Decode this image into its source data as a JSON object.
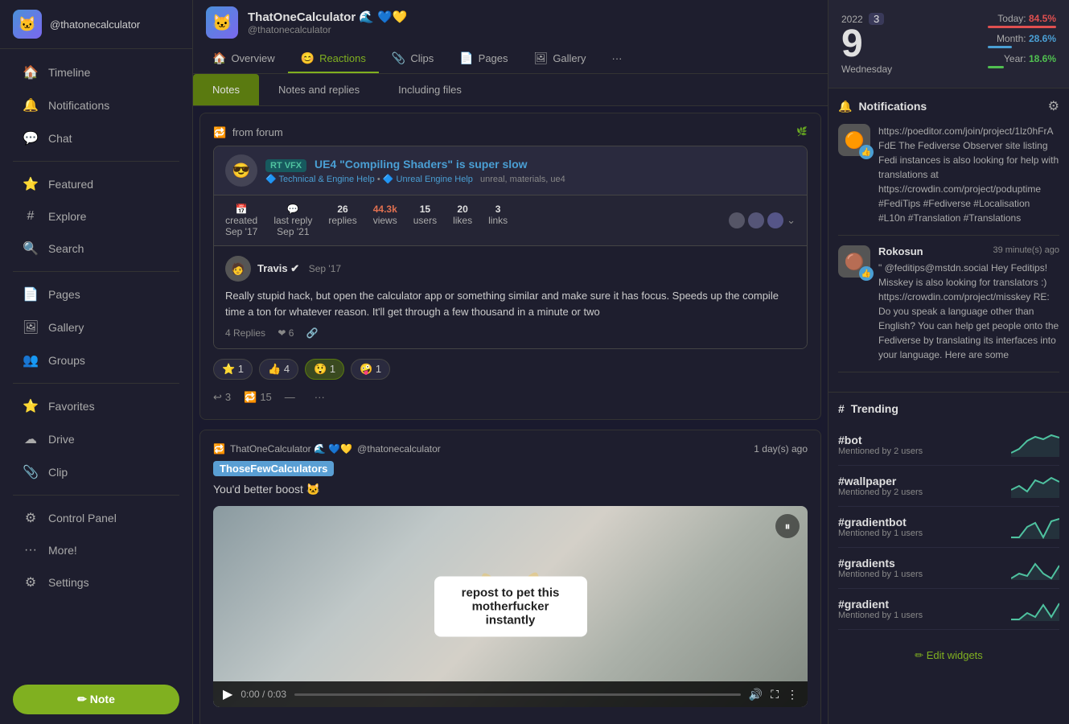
{
  "sidebar": {
    "username": "@thatonecalculator",
    "avatar_emoji": "🐱",
    "nav_items": [
      {
        "id": "timeline",
        "label": "Timeline",
        "icon": "🏠"
      },
      {
        "id": "notifications",
        "label": "Notifications",
        "icon": "🔔"
      },
      {
        "id": "chat",
        "label": "Chat",
        "icon": "💬"
      },
      {
        "id": "featured",
        "label": "Featured",
        "icon": "⭐"
      },
      {
        "id": "explore",
        "label": "Explore",
        "icon": "#"
      },
      {
        "id": "search",
        "label": "Search",
        "icon": "🔍"
      },
      {
        "id": "pages",
        "label": "Pages",
        "icon": "📄"
      },
      {
        "id": "gallery",
        "label": "Gallery",
        "icon": "🖼"
      },
      {
        "id": "groups",
        "label": "Groups",
        "icon": "👥"
      },
      {
        "id": "favorites",
        "label": "Favorites",
        "icon": "⭐"
      },
      {
        "id": "drive",
        "label": "Drive",
        "icon": "☁"
      },
      {
        "id": "clip",
        "label": "Clip",
        "icon": "📎"
      },
      {
        "id": "control_panel",
        "label": "Control Panel",
        "icon": "⚙"
      },
      {
        "id": "more",
        "label": "More!",
        "icon": "..."
      },
      {
        "id": "settings",
        "label": "Settings",
        "icon": "⚙"
      }
    ],
    "note_button": "✏ Note"
  },
  "profile_header": {
    "avatar_emoji": "🐱",
    "name": "ThatOneCalculator 🌊 💙💛",
    "handle": "@thatonecalculator",
    "tabs": [
      {
        "id": "overview",
        "label": "Overview",
        "icon": "🏠",
        "active": false
      },
      {
        "id": "reactions",
        "label": "Reactions",
        "icon": "😊",
        "active": true
      },
      {
        "id": "clips",
        "label": "Clips",
        "icon": "📎"
      },
      {
        "id": "pages",
        "label": "Pages",
        "icon": "📄"
      },
      {
        "id": "gallery",
        "label": "Gallery",
        "icon": "🖼"
      },
      {
        "id": "more",
        "label": "...",
        "icon": ""
      }
    ]
  },
  "content_tabs": [
    {
      "id": "notes",
      "label": "Notes",
      "active": true
    },
    {
      "id": "notes_replies",
      "label": "Notes and replies",
      "active": false
    },
    {
      "id": "including_files",
      "label": "Including files",
      "active": false
    }
  ],
  "posts": [
    {
      "id": "post1",
      "type": "embedded_forum",
      "embedded": {
        "avatar_emoji": "😎",
        "title": "UE4 \"Compiling Shaders\" is super slow",
        "subtitle": "Technical & Engine Help • Unreal Engine Help",
        "tags": "unreal, materials, ue4",
        "stats": [
          {
            "label": "created",
            "value": "Sep '17"
          },
          {
            "label": "last reply",
            "value": "Sep '21"
          },
          {
            "label": "replies",
            "value": "26"
          },
          {
            "label": "views",
            "value": "44.3k"
          },
          {
            "label": "users",
            "value": "15"
          },
          {
            "label": "likes",
            "value": "20"
          },
          {
            "label": "links",
            "value": "3"
          }
        ]
      },
      "reply": {
        "avatar_emoji": "🧑",
        "username": "Travis ✔",
        "timestamp": "Sep '17",
        "text": "Really stupid hack, but open the calculator app or something similar and make sure it has focus. Speeds up the compile time a ton for whatever reason. It'll get through a few thousand in a minute or two",
        "reply_count": "4 Replies",
        "likes": 6
      },
      "reactions": [
        {
          "emoji": "⭐",
          "count": 1,
          "active": false
        },
        {
          "emoji": "👍",
          "count": 4,
          "active": false
        },
        {
          "emoji": "😲",
          "count": 1,
          "active": true
        },
        {
          "emoji": "🤪",
          "count": 1,
          "active": false
        }
      ],
      "actions": {
        "reply_count": 3,
        "boost_count": 15
      }
    },
    {
      "id": "post2",
      "type": "boost",
      "boosted_by": "ThatOneCalculator 🌊 💙💛",
      "boosted_handle": "@thatonecalculator",
      "timestamp": "1 day(s) ago",
      "boost_tag": "ThoseFewCalculators",
      "text": "You'd better boost 🐱",
      "media_type": "video",
      "video_text": "repost to pet this motherfucker instantly",
      "video_duration": "0:03",
      "video_current": "0:00"
    }
  ],
  "right_sidebar": {
    "calendar": {
      "year": "2022",
      "month_number": "3",
      "day": "9",
      "weekday": "Wednesday",
      "stats": [
        {
          "label": "Today:",
          "value": "84.5%",
          "color": "#e05050",
          "width": "85%"
        },
        {
          "label": "Month:",
          "value": "28.6%",
          "color": "#4a9fd4",
          "width": "29%"
        },
        {
          "label": "Year:",
          "value": "18.6%",
          "color": "#50c050",
          "width": "19%"
        }
      ]
    },
    "notifications": {
      "title": "Notifications",
      "items": [
        {
          "avatar_emoji": "🟠",
          "badge": "👍",
          "name": "",
          "text": "https://poeditor.com/join/project/1lz0hFrA FdE  The Fediverse Observer site listing Fedi instances is also looking for help with translations at https://crowdin.com/project/poduptime #FediTips #Fediverse #Localisation #L10n #Translation #Translations"
        },
        {
          "avatar_emoji": "🟤",
          "badge": "👍",
          "name": "Rokosun",
          "timestamp": "39 minute(s) ago",
          "text": "\" @feditips@mstdn.social Hey Feditips! Misskey is also looking for translators :) https://crowdin.com/project/misskey  RE: Do you speak a language other than English?  You can help get people onto the Fediverse by translating its interfaces into your language.  Here are some"
        }
      ]
    },
    "trending": {
      "title": "Trending",
      "items": [
        {
          "tag": "#bot",
          "count": "Mentioned by 2 users"
        },
        {
          "tag": "#wallpaper",
          "count": "Mentioned by 2 users"
        },
        {
          "tag": "#gradientbot",
          "count": "Mentioned by 1 users"
        },
        {
          "tag": "#gradients",
          "count": "Mentioned by 1 users"
        },
        {
          "tag": "#gradient",
          "count": "Mentioned by 1 users"
        }
      ]
    },
    "edit_widgets": "✏ Edit widgets"
  }
}
